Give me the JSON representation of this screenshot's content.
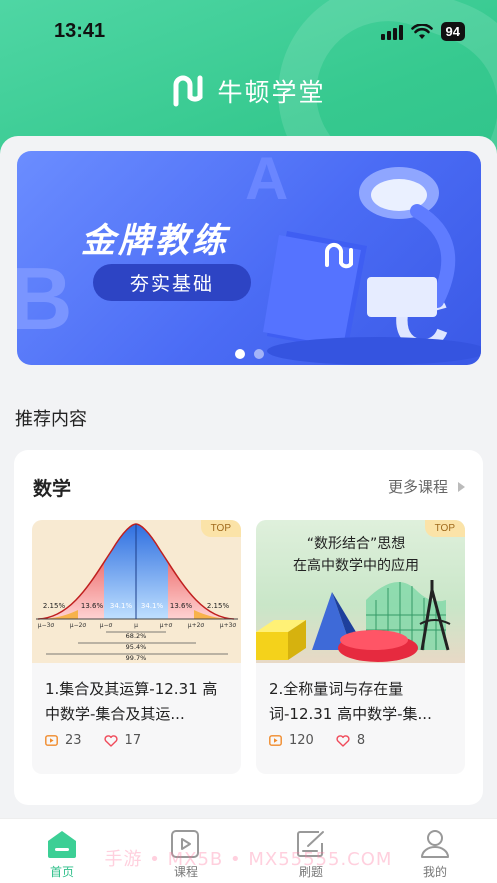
{
  "status_bar": {
    "time": "13:41",
    "battery": "94"
  },
  "brand": {
    "name": "牛顿学堂",
    "logo_icon": "n-logo-icon"
  },
  "banner": {
    "title": "金牌教练",
    "subtitle": "夯实基础",
    "letters": [
      "A",
      "B",
      "C"
    ],
    "active_dot": 0,
    "dot_count": 2
  },
  "section": {
    "title": "推荐内容"
  },
  "subject": {
    "name": "数学",
    "more_label": "更多课程",
    "courses": [
      {
        "title": "1.集合及其运算-12.31 高中数学-集合及其运...",
        "badge": "TOP",
        "plays": "23",
        "likes": "17",
        "thumb_labels": {
          "p1": "2.15%",
          "p2": "13.6%",
          "p3": "34.1%",
          "p4": "34.1%",
          "p5": "13.6%",
          "p6": "2.15%",
          "r1": "68.2%",
          "r2": "95.4%",
          "r3": "99.7%",
          "ticks": [
            "μ−3σ",
            "μ−2σ",
            "μ−σ",
            "μ",
            "μ+σ",
            "μ+2σ",
            "μ+3σ"
          ]
        }
      },
      {
        "title": "2.全称量词与存在量词-12.31 高中数学-集...",
        "badge": "TOP",
        "plays": "120",
        "likes": "8",
        "thumb_labels": {
          "line1": "“数形结合”思想",
          "line2": "在高中数学中的应用"
        }
      }
    ]
  },
  "tabs": [
    {
      "label": "首页",
      "icon": "home-icon",
      "active": true
    },
    {
      "label": "课程",
      "icon": "video-course-icon",
      "active": false
    },
    {
      "label": "刷题",
      "icon": "edit-exercise-icon",
      "active": false
    },
    {
      "label": "我的",
      "icon": "user-profile-icon",
      "active": false
    }
  ],
  "watermark": "手游 • MX5B • MX55555.COM",
  "colors": {
    "brand_green": "#36c98f",
    "banner_blue": "#4b6cf5",
    "active_tab": "#2fbf8a"
  }
}
